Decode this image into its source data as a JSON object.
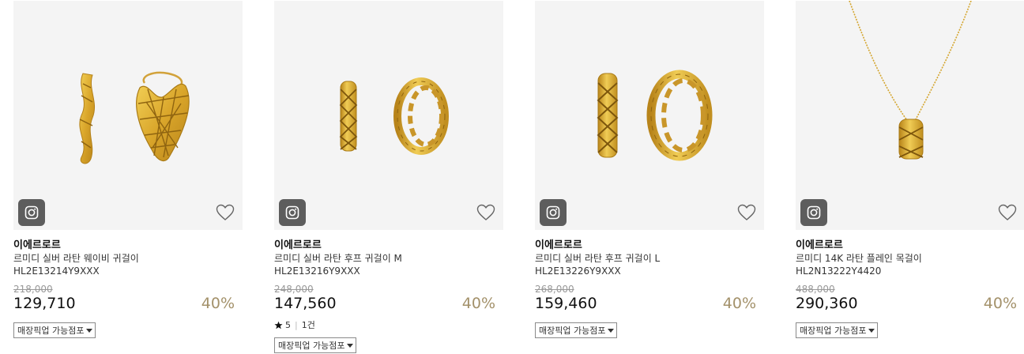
{
  "products": [
    {
      "brand": "이에르로르",
      "name": "르미디 실버 라탄 웨이비 귀걸이",
      "code": "HL2E13214Y9XXX",
      "original_price": "218,000",
      "price": "129,710",
      "discount": "40%",
      "pickup_label": "매장픽업 가능점포",
      "image_icon": "earrings-wavy"
    },
    {
      "brand": "이에르로르",
      "name": "르미디 실버 라탄 후프 귀걸이 M",
      "code": "HL2E13216Y9XXX",
      "original_price": "248,000",
      "price": "147,560",
      "discount": "40%",
      "rating": "5",
      "review_count": "1건",
      "pickup_label": "매장픽업 가능점포",
      "image_icon": "earrings-hoop-m"
    },
    {
      "brand": "이에르로르",
      "name": "르미디 실버 라탄 후프 귀걸이 L",
      "code": "HL2E13226Y9XXX",
      "original_price": "268,000",
      "price": "159,460",
      "discount": "40%",
      "pickup_label": "매장픽업 가능점포",
      "image_icon": "earrings-hoop-l"
    },
    {
      "brand": "이에르로르",
      "name": "르미디 14K 라탄 플레인 목걸이",
      "code": "HL2N13222Y4420",
      "original_price": "488,000",
      "price": "290,360",
      "discount": "40%",
      "pickup_label": "매장픽업 가능점포",
      "image_icon": "necklace-pendant"
    }
  ],
  "colors": {
    "thumb_bg": "#f4f4f4",
    "gold": "#d7a82a",
    "discount": "#a3916a",
    "insta_badge": "#5d5d5d"
  },
  "icons": {
    "instagram": "instagram-icon",
    "wishlist": "heart-outline-icon",
    "rating": "star-icon",
    "dropdown": "caret-down-icon"
  }
}
